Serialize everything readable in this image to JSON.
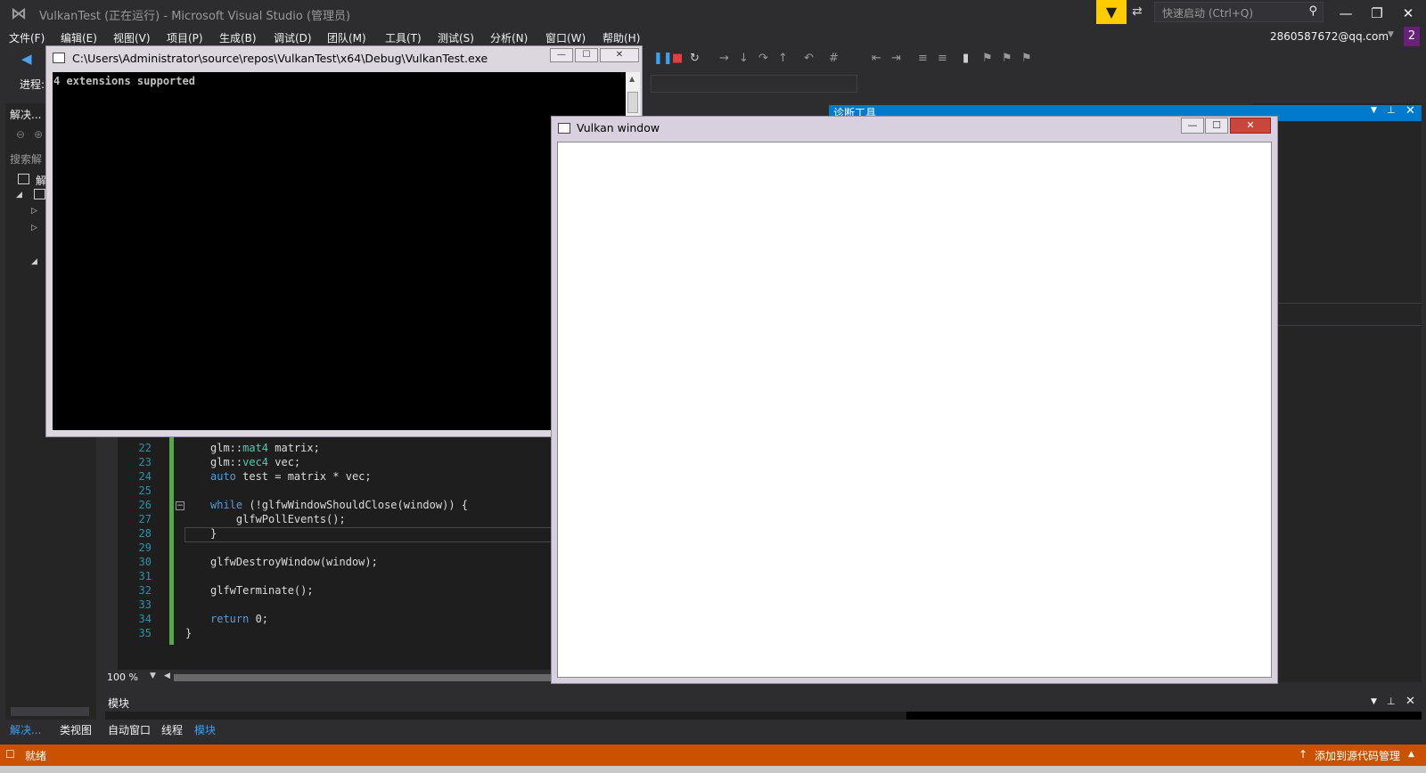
{
  "titlebar": {
    "title": "VulkanTest (正在运行) - Microsoft Visual Studio (管理员)",
    "quick_launch_placeholder": "快速启动 (Ctrl+Q)",
    "minimize": "—",
    "restore": "❐",
    "close": "✕"
  },
  "menu": {
    "items": [
      "文件(F)",
      "编辑(E)",
      "视图(V)",
      "项目(P)",
      "生成(B)",
      "调试(D)",
      "团队(M)",
      "工具(T)",
      "测试(S)",
      "分析(N)",
      "窗口(W)",
      "帮助(H)"
    ],
    "account": "2860587672@qq.com",
    "notifications": "2"
  },
  "toolbar": {
    "process_label": "进程:"
  },
  "solution_explorer": {
    "title": "解决...",
    "search": "搜索解",
    "item_label": "解"
  },
  "diagnostics": {
    "title": "诊断工具"
  },
  "editor": {
    "zoom": "100 %",
    "lines": [
      {
        "n": "22",
        "code": "glm::mat4 matrix;"
      },
      {
        "n": "23",
        "code": "glm::vec4 vec;"
      },
      {
        "n": "24",
        "code": "auto test = matrix * vec;"
      },
      {
        "n": "25",
        "code": ""
      },
      {
        "n": "26",
        "code": "while (!glfwWindowShouldClose(window)) {"
      },
      {
        "n": "27",
        "code": "    glfwPollEvents();"
      },
      {
        "n": "28",
        "code": "}"
      },
      {
        "n": "29",
        "code": ""
      },
      {
        "n": "30",
        "code": "glfwDestroyWindow(window);"
      },
      {
        "n": "31",
        "code": ""
      },
      {
        "n": "32",
        "code": "glfwTerminate();"
      },
      {
        "n": "33",
        "code": ""
      },
      {
        "n": "34",
        "code": "return 0;"
      },
      {
        "n": "35",
        "code": "}"
      }
    ]
  },
  "modules_panel": {
    "title": "模块"
  },
  "bottom_tabs": [
    "解决...",
    "类视图",
    "自动窗口",
    "线程",
    "模块"
  ],
  "statusbar": {
    "status": "就绪",
    "source_control": "添加到源代码管理"
  },
  "console_window": {
    "title": "C:\\Users\\Administrator\\source\\repos\\VulkanTest\\x64\\Debug\\VulkanTest.exe",
    "output": "4 extensions supported"
  },
  "vulkan_window": {
    "title": "Vulkan window"
  },
  "colors": {
    "accent": "#007acc",
    "status_bar": "#ca5100",
    "filter_highlight": "#ffcc00"
  }
}
